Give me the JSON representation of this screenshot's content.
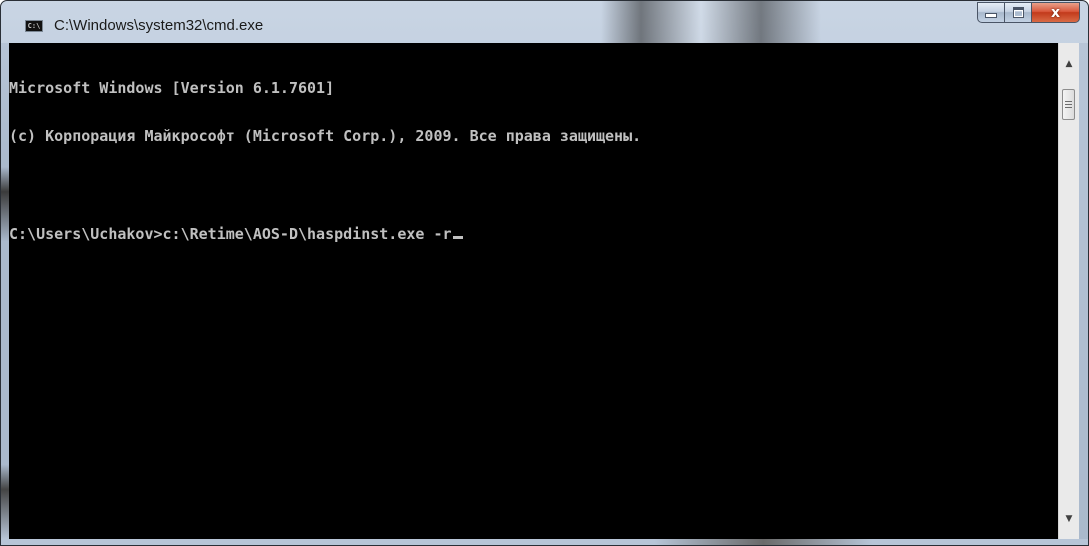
{
  "window": {
    "title": "C:\\Windows\\system32\\cmd.exe",
    "icon_label": "C:\\",
    "icon": "console-app-icon",
    "buttons": {
      "minimize": "minimize-icon",
      "maximize": "maximize-icon",
      "close_glyph": "x"
    }
  },
  "console": {
    "lines": [
      "Microsoft Windows [Version 6.1.7601]",
      "(c) Корпорация Майкрософт (Microsoft Corp.), 2009. Все права защищены.",
      "",
      "C:\\Users\\Uchakov>c:\\Retime\\AOS-D\\haspdinst.exe -r"
    ],
    "text_color": "#c0c0c0",
    "background_color": "#000000"
  },
  "scrollbar": {
    "up_arrow": "▲",
    "down_arrow": "▼"
  }
}
